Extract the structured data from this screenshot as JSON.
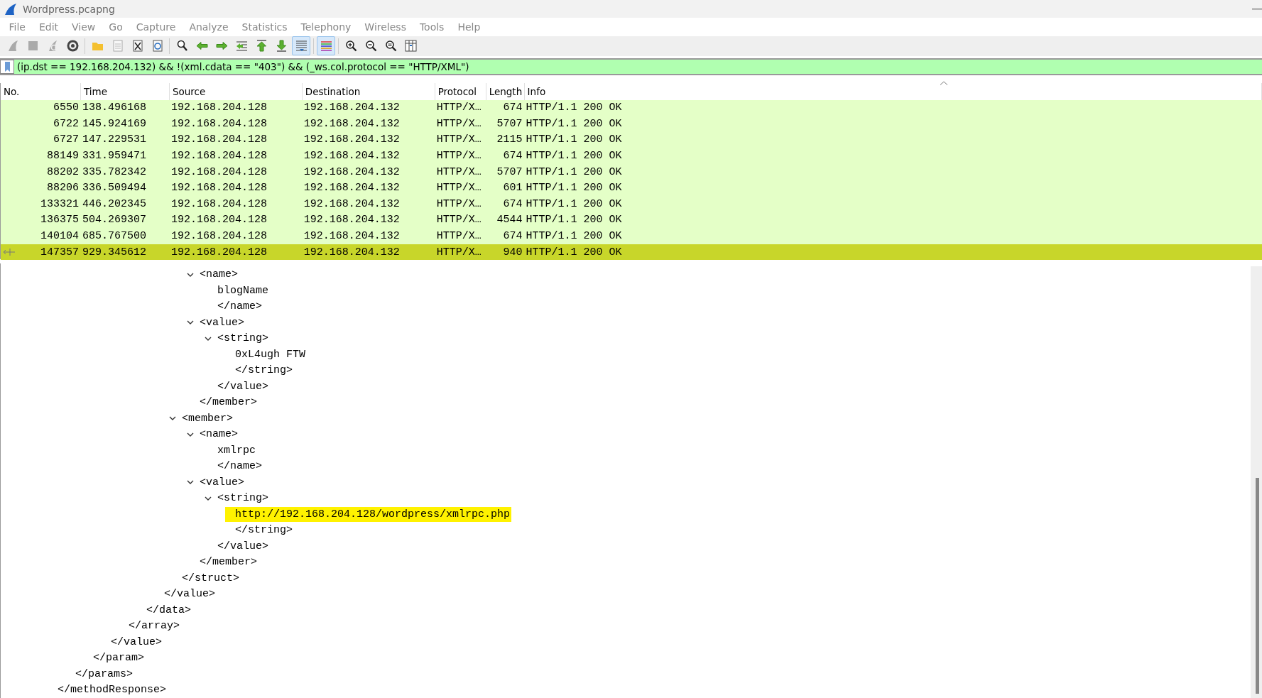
{
  "window": {
    "title": "Wordpress.pcapng"
  },
  "menu": [
    "File",
    "Edit",
    "View",
    "Go",
    "Capture",
    "Analyze",
    "Statistics",
    "Telephony",
    "Wireless",
    "Tools",
    "Help"
  ],
  "toolbar": [
    [
      {
        "kind": "fin",
        "disabled": true,
        "pressed": false
      },
      {
        "kind": "stop",
        "disabled": true,
        "pressed": false
      },
      {
        "kind": "restart",
        "disabled": true,
        "pressed": false
      },
      {
        "kind": "gear",
        "disabled": false,
        "pressed": false
      }
    ],
    [
      {
        "kind": "folder",
        "disabled": false,
        "pressed": false
      },
      {
        "kind": "file",
        "disabled": false,
        "pressed": false
      },
      {
        "kind": "close",
        "disabled": false,
        "pressed": false
      },
      {
        "kind": "reload",
        "disabled": false,
        "pressed": false
      }
    ],
    [
      {
        "kind": "find",
        "disabled": false,
        "pressed": false
      },
      {
        "kind": "back",
        "disabled": false,
        "pressed": false
      },
      {
        "kind": "forward",
        "disabled": false,
        "pressed": false
      },
      {
        "kind": "goto",
        "disabled": false,
        "pressed": false
      },
      {
        "kind": "first",
        "disabled": false,
        "pressed": false
      },
      {
        "kind": "last",
        "disabled": false,
        "pressed": false
      },
      {
        "kind": "autoscroll",
        "disabled": false,
        "pressed": true
      }
    ],
    [
      {
        "kind": "colorize",
        "disabled": false,
        "pressed": true
      }
    ],
    [
      {
        "kind": "zoom-in",
        "disabled": false,
        "pressed": false
      },
      {
        "kind": "zoom-out",
        "disabled": false,
        "pressed": false
      },
      {
        "kind": "zoom-reset",
        "disabled": false,
        "pressed": false
      },
      {
        "kind": "columns",
        "disabled": false,
        "pressed": false
      }
    ]
  ],
  "filter": {
    "value": "(ip.dst == 192.168.204.132) && !(xml.cdata == \"403\") && (_ws.col.protocol == \"HTTP/XML\")"
  },
  "packet_list": {
    "columns": [
      "No.",
      "Time",
      "Source",
      "Destination",
      "Protocol",
      "Length",
      "Info"
    ],
    "rows": [
      {
        "cells": [
          "6550",
          "138.496168",
          "192.168.204.128",
          "192.168.204.132",
          "HTTP/X…",
          "674",
          "HTTP/1.1 200 OK"
        ],
        "selected": false
      },
      {
        "cells": [
          "6722",
          "145.924169",
          "192.168.204.128",
          "192.168.204.132",
          "HTTP/X…",
          "5707",
          "HTTP/1.1 200 OK"
        ],
        "selected": false
      },
      {
        "cells": [
          "6727",
          "147.229531",
          "192.168.204.128",
          "192.168.204.132",
          "HTTP/X…",
          "2115",
          "HTTP/1.1 200 OK"
        ],
        "selected": false
      },
      {
        "cells": [
          "88149",
          "331.959471",
          "192.168.204.128",
          "192.168.204.132",
          "HTTP/X…",
          "674",
          "HTTP/1.1 200 OK"
        ],
        "selected": false
      },
      {
        "cells": [
          "88202",
          "335.782342",
          "192.168.204.128",
          "192.168.204.132",
          "HTTP/X…",
          "5707",
          "HTTP/1.1 200 OK"
        ],
        "selected": false
      },
      {
        "cells": [
          "88206",
          "336.509494",
          "192.168.204.128",
          "192.168.204.132",
          "HTTP/X…",
          "601",
          "HTTP/1.1 200 OK"
        ],
        "selected": false
      },
      {
        "cells": [
          "133321",
          "446.202345",
          "192.168.204.128",
          "192.168.204.132",
          "HTTP/X…",
          "674",
          "HTTP/1.1 200 OK"
        ],
        "selected": false
      },
      {
        "cells": [
          "136375",
          "504.269307",
          "192.168.204.128",
          "192.168.204.132",
          "HTTP/X…",
          "4544",
          "HTTP/1.1 200 OK"
        ],
        "selected": false
      },
      {
        "cells": [
          "140104",
          "685.767500",
          "192.168.204.128",
          "192.168.204.132",
          "HTTP/X…",
          "674",
          "HTTP/1.1 200 OK"
        ],
        "selected": false
      },
      {
        "cells": [
          "147357",
          "929.345612",
          "192.168.204.128",
          "192.168.204.132",
          "HTTP/X…",
          "940",
          "HTTP/1.1 200 OK"
        ],
        "selected": true
      }
    ]
  },
  "tree": {
    "nodes": [
      {
        "children": [
          {
            "children": [
              {
                "children": [
                  {
                    "children": [
                      {
                        "children": [
                          {
                            "children": [
                              {
                                "children": [
                                  {
                                    "children": [
                                      {
                                        "children": [
                                          {
                                            "label": "<name>",
                                            "expanded": true,
                                            "children": [
                                              {
                                                "label": "blogName"
                                              },
                                              {
                                                "label": "</name>"
                                              }
                                            ]
                                          },
                                          {
                                            "label": "<value>",
                                            "expanded": true,
                                            "children": [
                                              {
                                                "label": "<string>",
                                                "expanded": true,
                                                "children": [
                                                  {
                                                    "label": "0xL4ugh FTW"
                                                  },
                                                  {
                                                    "label": "</string>"
                                                  }
                                                ]
                                              },
                                              {
                                                "label": "</value>"
                                              }
                                            ]
                                          },
                                          {
                                            "label": "</member>"
                                          }
                                        ]
                                      },
                                      {
                                        "label": "<member>",
                                        "expanded": true,
                                        "children": [
                                          {
                                            "label": "<name>",
                                            "expanded": true,
                                            "children": [
                                              {
                                                "label": "xmlrpc"
                                              },
                                              {
                                                "label": "</name>"
                                              }
                                            ]
                                          },
                                          {
                                            "label": "<value>",
                                            "expanded": true,
                                            "children": [
                                              {
                                                "label": "<string>",
                                                "expanded": true,
                                                "children": [
                                                  {
                                                    "label": "http://192.168.204.128/wordpress/xmlrpc.php",
                                                    "highlighted": true
                                                  },
                                                  {
                                                    "label": "</string>"
                                                  }
                                                ]
                                              },
                                              {
                                                "label": "</value>"
                                              }
                                            ]
                                          },
                                          {
                                            "label": "</member>"
                                          }
                                        ]
                                      },
                                      {
                                        "label": "</struct>"
                                      }
                                    ]
                                  },
                                  {
                                    "label": "</value>"
                                  }
                                ]
                              },
                              {
                                "label": "</data>"
                              }
                            ]
                          },
                          {
                            "label": "</array>"
                          }
                        ]
                      },
                      {
                        "label": "</value>"
                      }
                    ]
                  },
                  {
                    "label": "</param>"
                  }
                ]
              },
              {
                "label": "</params>"
              }
            ]
          },
          {
            "label": "</methodResponse>"
          }
        ]
      }
    ]
  }
}
